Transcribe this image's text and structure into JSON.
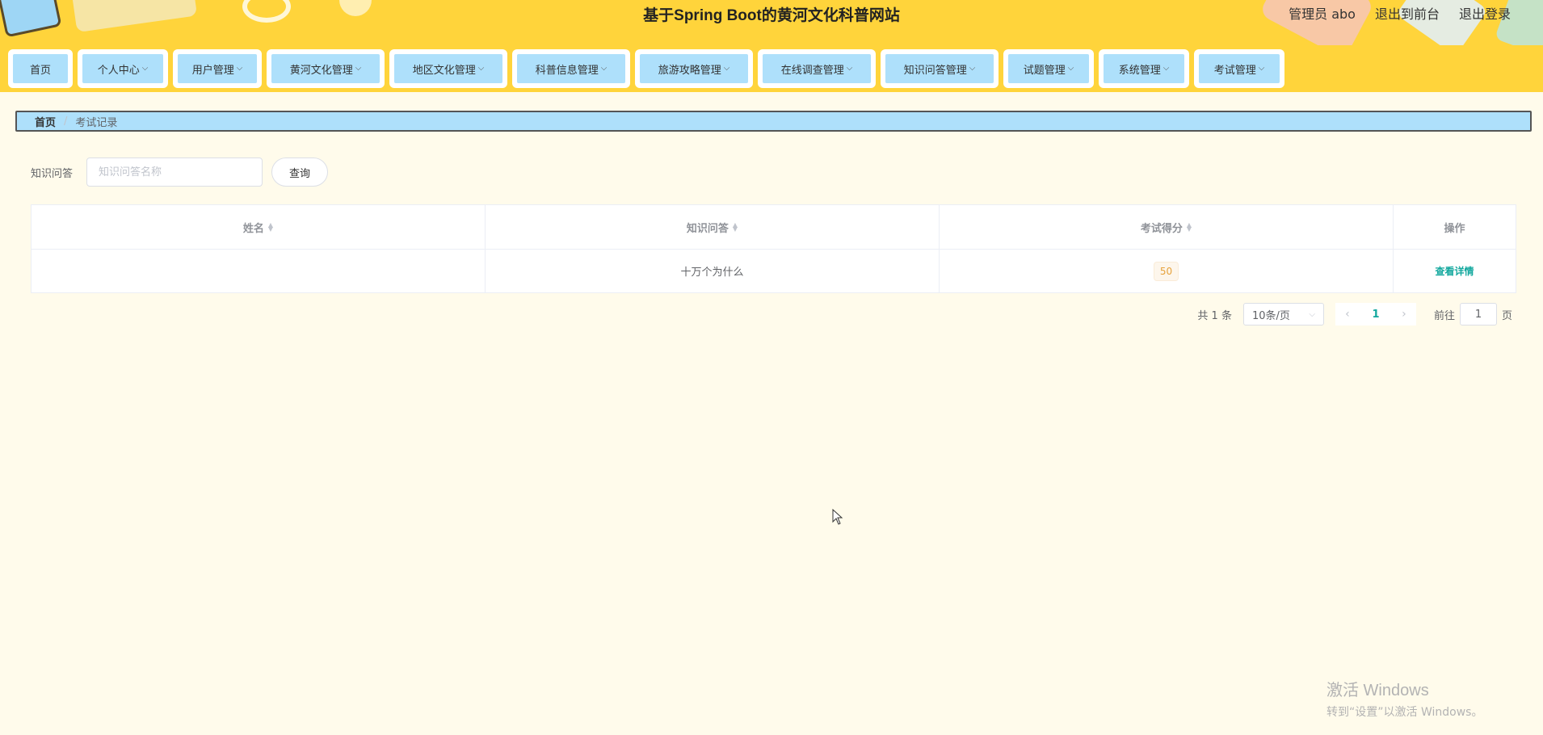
{
  "header": {
    "title": "基于Spring Boot的黄河文化科普网站",
    "user_label": "管理员 abo",
    "to_front": "退出到前台",
    "logout": "退出登录"
  },
  "nav": {
    "items": [
      {
        "label": "首页",
        "has_dropdown": false
      },
      {
        "label": "个人中心",
        "has_dropdown": true
      },
      {
        "label": "用户管理",
        "has_dropdown": true
      },
      {
        "label": "黄河文化管理",
        "has_dropdown": true
      },
      {
        "label": "地区文化管理",
        "has_dropdown": true
      },
      {
        "label": "科普信息管理",
        "has_dropdown": true
      },
      {
        "label": "旅游攻略管理",
        "has_dropdown": true
      },
      {
        "label": "在线调查管理",
        "has_dropdown": true
      },
      {
        "label": "知识问答管理",
        "has_dropdown": true
      },
      {
        "label": "试题管理",
        "has_dropdown": true
      },
      {
        "label": "系统管理",
        "has_dropdown": true
      },
      {
        "label": "考试管理",
        "has_dropdown": true
      }
    ]
  },
  "breadcrumb": {
    "home": "首页",
    "separator": "/",
    "current": "考试记录"
  },
  "search": {
    "label": "知识问答",
    "placeholder": "知识问答名称",
    "value": "",
    "button": "查询"
  },
  "table": {
    "columns": [
      "姓名",
      "知识问答",
      "考试得分",
      "操作"
    ],
    "rows": [
      {
        "name": "",
        "quiz": "十万个为什么",
        "score": "50",
        "action": "查看详情"
      }
    ]
  },
  "pagination": {
    "total": "共 1 条",
    "page_size": "10条/页",
    "current_page": "1",
    "goto_label": "前往",
    "goto_value": "1",
    "page_unit": "页"
  },
  "watermark": {
    "line1": "激活 Windows",
    "line2": "转到“设置”以激活 Windows。"
  },
  "colors": {
    "header_bg": "#ffd43b",
    "nav_button_bg": "#aee0fb",
    "page_bg": "#fffbeb",
    "accent": "#13a89e",
    "score_badge": "#e6a23c"
  }
}
